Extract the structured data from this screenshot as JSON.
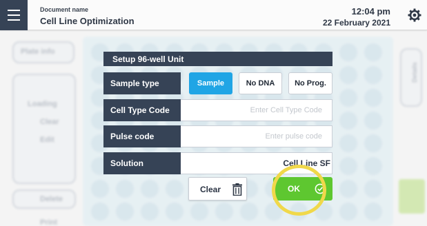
{
  "header": {
    "document_label": "Document name",
    "document_name": "Cell Line Optimization",
    "time": "12:04 pm",
    "date": "22 February 2021"
  },
  "background": {
    "left_items": [
      "Plate info",
      "Loading",
      "Clear",
      "Edit",
      "Delete",
      "Print"
    ],
    "right_tab": "Details"
  },
  "dialog": {
    "title": "Setup 96-well Unit",
    "sample_type": {
      "label": "Sample type",
      "options": [
        "Sample",
        "No DNA",
        "No Prog."
      ],
      "selected": "Sample"
    },
    "cell_type_code": {
      "label": "Cell Type Code",
      "value": "",
      "placeholder": "Enter Cell Type Code"
    },
    "pulse_code": {
      "label": "Pulse code",
      "value": "",
      "placeholder": "Enter pulse code"
    },
    "solution": {
      "label": "Solution",
      "value": "Cell Line SF"
    },
    "clear_label": "Clear",
    "ok_label": "OK"
  },
  "colors": {
    "header_dark": "#364356",
    "selected_blue": "#20a5e5",
    "ok_green": "#5ec730",
    "highlight_yellow": "#f0d84a"
  },
  "icons": [
    "menu-icon",
    "settings-icon",
    "trash-icon",
    "check-circle-icon"
  ]
}
